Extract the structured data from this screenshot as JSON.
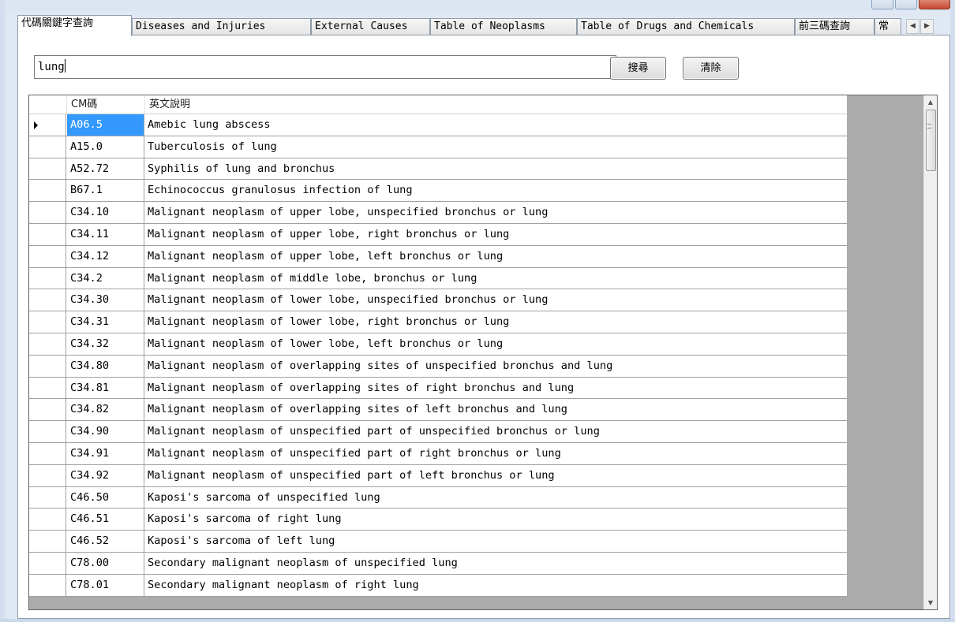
{
  "tabs": [
    {
      "label": "代碼關鍵字查詢",
      "active": true
    },
    {
      "label": "Diseases and Injuries",
      "active": false
    },
    {
      "label": "External Causes",
      "active": false
    },
    {
      "label": "Table of Neoplasms",
      "active": false
    },
    {
      "label": "Table of Drugs and Chemicals",
      "active": false
    },
    {
      "label": "前三碼查詢",
      "active": false
    },
    {
      "label": "常",
      "active": false
    }
  ],
  "search": {
    "value": "lung",
    "search_label": "搜尋",
    "clear_label": "清除"
  },
  "grid": {
    "columns": [
      "CM碼",
      "英文說明"
    ],
    "rows": [
      {
        "code": "A06.5",
        "desc": "Amebic lung abscess"
      },
      {
        "code": "A15.0",
        "desc": "Tuberculosis of lung"
      },
      {
        "code": "A52.72",
        "desc": "Syphilis of lung and bronchus"
      },
      {
        "code": "B67.1",
        "desc": "Echinococcus granulosus infection of lung"
      },
      {
        "code": "C34.10",
        "desc": "Malignant neoplasm of upper lobe, unspecified bronchus or lung"
      },
      {
        "code": "C34.11",
        "desc": "Malignant neoplasm of upper lobe, right bronchus or lung"
      },
      {
        "code": "C34.12",
        "desc": "Malignant neoplasm of upper lobe, left bronchus or lung"
      },
      {
        "code": "C34.2",
        "desc": "Malignant neoplasm of middle lobe, bronchus or lung"
      },
      {
        "code": "C34.30",
        "desc": "Malignant neoplasm of lower lobe, unspecified bronchus or lung"
      },
      {
        "code": "C34.31",
        "desc": "Malignant neoplasm of lower lobe, right bronchus or lung"
      },
      {
        "code": "C34.32",
        "desc": "Malignant neoplasm of lower lobe, left bronchus or lung"
      },
      {
        "code": "C34.80",
        "desc": "Malignant neoplasm of overlapping sites of unspecified bronchus and lung"
      },
      {
        "code": "C34.81",
        "desc": "Malignant neoplasm of overlapping sites of right bronchus and lung"
      },
      {
        "code": "C34.82",
        "desc": "Malignant neoplasm of overlapping sites of left bronchus and lung"
      },
      {
        "code": "C34.90",
        "desc": "Malignant neoplasm of unspecified part of unspecified bronchus or lung"
      },
      {
        "code": "C34.91",
        "desc": "Malignant neoplasm of unspecified part of right bronchus or lung"
      },
      {
        "code": "C34.92",
        "desc": "Malignant neoplasm of unspecified part of left bronchus or lung"
      },
      {
        "code": "C46.50",
        "desc": "Kaposi's sarcoma of unspecified lung"
      },
      {
        "code": "C46.51",
        "desc": "Kaposi's sarcoma of right lung"
      },
      {
        "code": "C46.52",
        "desc": "Kaposi's sarcoma of left lung"
      },
      {
        "code": "C78.00",
        "desc": "Secondary malignant neoplasm of unspecified lung"
      },
      {
        "code": "C78.01",
        "desc": "Secondary malignant neoplasm of right lung"
      }
    ],
    "selected_index": 0
  },
  "colors": {
    "selection": "#3399ff",
    "grid_background": "#ababab"
  }
}
